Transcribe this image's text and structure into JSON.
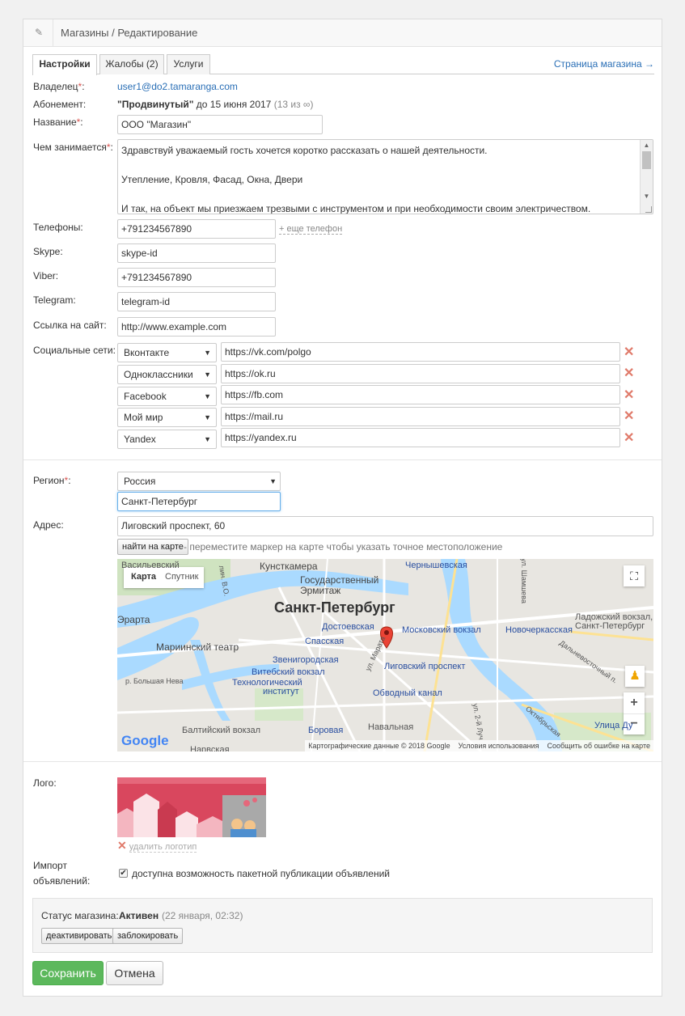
{
  "header": {
    "title": "Магазины / Редактирование"
  },
  "tabs": [
    {
      "label": "Настройки"
    },
    {
      "label": "Жалобы (2)"
    },
    {
      "label": "Услуги"
    }
  ],
  "store_link": "Страница магазина →",
  "owner": {
    "label": "Владелец",
    "value": "user1@do2.tamaranga.com"
  },
  "subscription": {
    "label": "Абонемент:",
    "plan": "\"Продвинутый\"",
    "until": "до 15 июня 2017",
    "count": "(13 из ∞)"
  },
  "name": {
    "label": "Название",
    "value": "ООО \"Магазин\""
  },
  "description": {
    "label": "Чем занимается",
    "lines": [
      "Здравствуй уважаемый гость хочется коротко рассказать о нашей деятельности.",
      "",
      "Утепление, Кровля, Фасад, Окна, Двери",
      "",
      "И так, на объект мы приезжаем трезвыми с инструментом и при необходимости своим электричеством."
    ]
  },
  "phones": {
    "label": "Телефоны:",
    "value": "+791234567890",
    "add_link": "+ еще телефон"
  },
  "skype": {
    "label": "Skype:",
    "value": "skype-id"
  },
  "viber": {
    "label": "Viber:",
    "value": "+791234567890"
  },
  "telegram": {
    "label": "Telegram:",
    "value": "telegram-id"
  },
  "website": {
    "label": "Ссылка на сайт:",
    "value": "http://www.example.com"
  },
  "social": {
    "label": "Социальные сети:",
    "rows": [
      {
        "network": "Вконтакте",
        "url": "https://vk.com/polgo"
      },
      {
        "network": "Одноклассники",
        "url": "https://ok.ru"
      },
      {
        "network": "Facebook",
        "url": "https://fb.com"
      },
      {
        "network": "Мой мир",
        "url": "https://mail.ru"
      },
      {
        "network": "Yandex",
        "url": "https://yandex.ru"
      }
    ]
  },
  "region": {
    "label": "Регион",
    "country": "Россия",
    "city": "Санкт-Петербург"
  },
  "address": {
    "label": "Адрес:",
    "value": "Лиговский проспект, 60",
    "find_button": "найти на карте",
    "hint": "- переместите маркер на карте чтобы указать точное местоположение"
  },
  "map": {
    "type_map": "Карта",
    "type_satellite": "Спутник",
    "city": "Санкт-Петербург",
    "labels": {
      "kunstkamera": "Кунсткамера",
      "hermitage_1": "Государственный",
      "hermitage_2": "Эрмитаж",
      "chernyshevskaya": "Чернышевская",
      "erarta": "Эрарта",
      "dostoevskaya": "Достоевская",
      "moskovsky": "Московский вокзал",
      "novocherkasskaya": "Новочеркасская",
      "ladozhsky_1": "Ладожский вокзал,",
      "ladozhsky_2": "Санкт-Петербург",
      "mariinsky": "Мариинский театр",
      "spasskaya": "Спасская",
      "zvenigorodskaya": "Звенигородская",
      "ligovsky": "Лиговский проспект",
      "vitebsky": "Витебский вокзал",
      "tech_1": "Технологический",
      "tech_2": "институт",
      "obvodny": "Обводный канал",
      "naval": "Навальная",
      "borovaya": "Боровая",
      "baltic": "Балтийский вокзал",
      "vasilievsky": "Васильевский",
      "nevsky": "Нарвская",
      "oktyabrskaya": "Октябрьская",
      "dalnevostochny": "Дальневосточный п.",
      "ulitsa_dy": "Улица Ду",
      "bolshaya_neva": "р. Большая Нева",
      "shamsheva": "ул. Шамшева",
      "lin": "лин. В.О.",
      "ul_marat": "ул. Марата",
      "ul_2lucha": "ул. 2-й Луч"
    },
    "google": "Google",
    "footer_data": "Картографические данные © 2018 Google",
    "footer_terms": "Условия использования",
    "footer_report": "Сообщить об ошибке на карте"
  },
  "logo": {
    "label": "Лого:",
    "remove_link": "удалить логотип"
  },
  "import": {
    "label_1": "Импорт",
    "label_2": "объявлений:",
    "checkbox_label": "доступна возможность пакетной публикации объявлений",
    "checked": true
  },
  "status": {
    "label": "Статус магазина:",
    "value": "Активен",
    "date": "(22 января, 02:32)",
    "deactivate": "деактивировать",
    "block": "заблокировать"
  },
  "actions": {
    "save": "Сохранить",
    "cancel": "Отмена"
  },
  "colors": {
    "accent_link": "#2a6fb6",
    "save_green": "#5cb85c",
    "required": "#d9534f",
    "delete": "#e07a6a"
  }
}
